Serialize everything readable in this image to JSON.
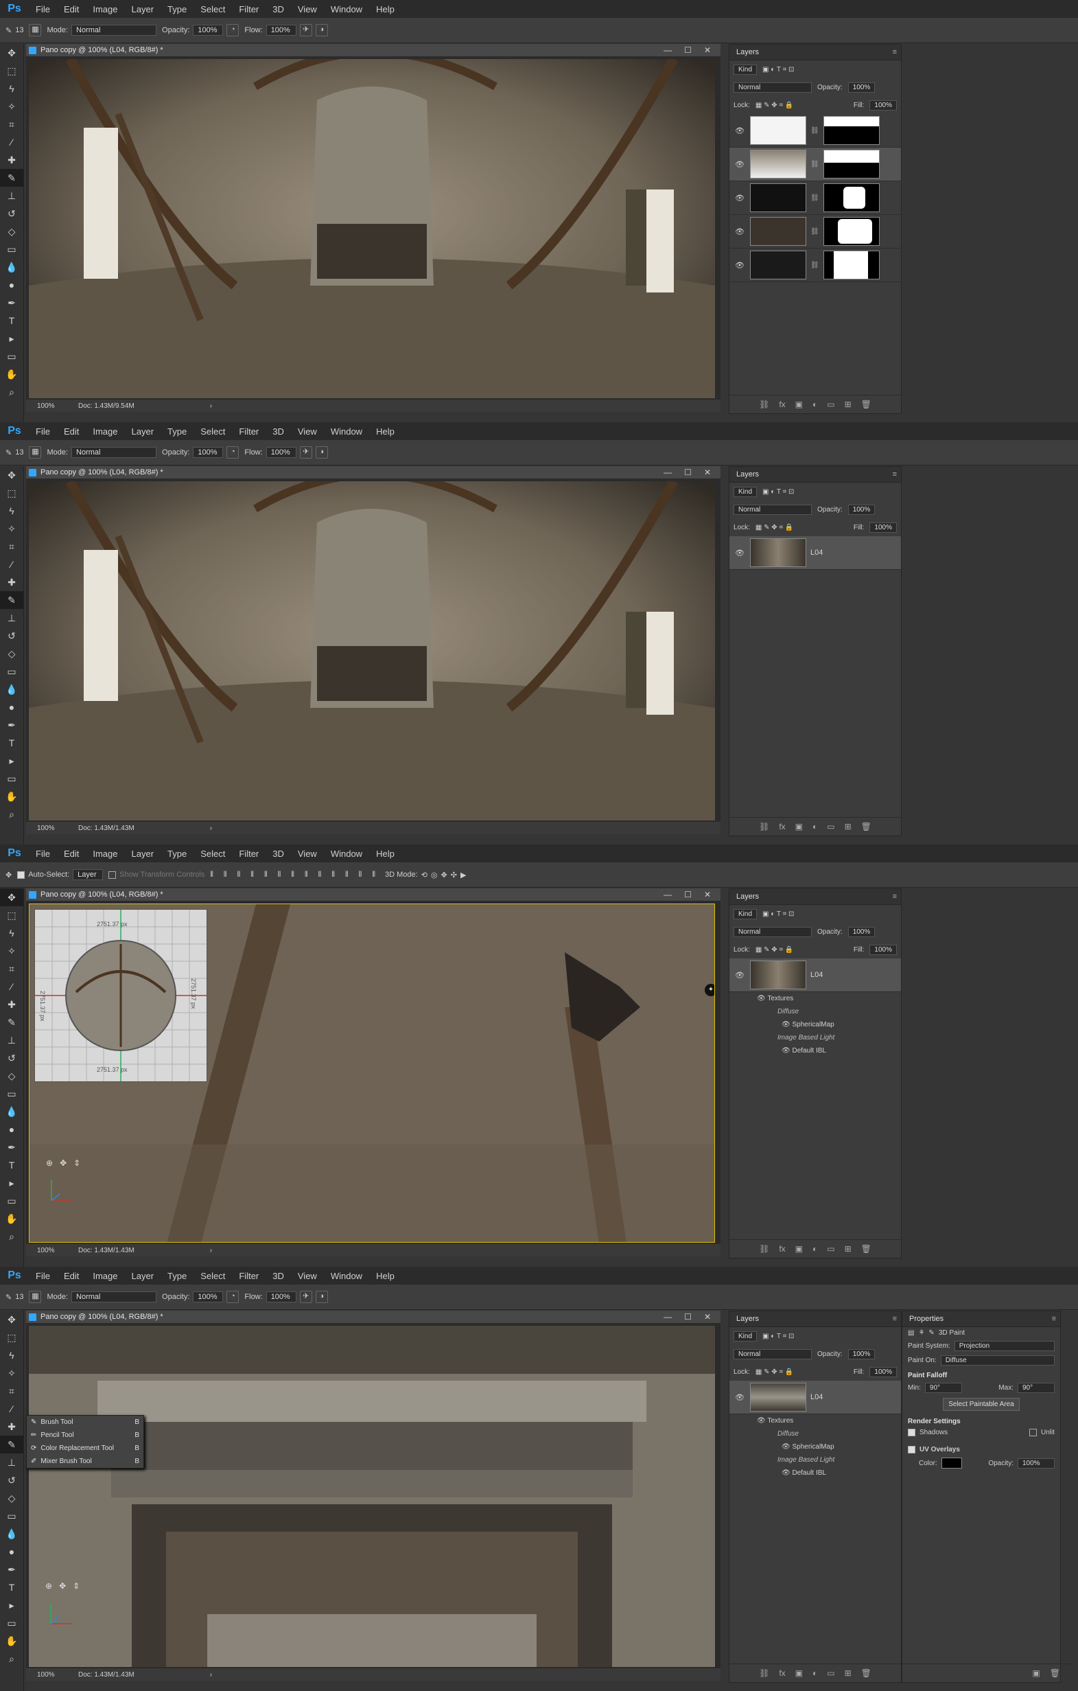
{
  "app": {
    "logo": "Ps"
  },
  "menu": [
    "File",
    "Edit",
    "Image",
    "Layer",
    "Type",
    "Select",
    "Filter",
    "3D",
    "View",
    "Window",
    "Help"
  ],
  "brush_options": {
    "brush_size": "13",
    "mode_label": "Mode:",
    "mode_value": "Normal",
    "opacity_label": "Opacity:",
    "opacity_value": "100%",
    "flow_label": "Flow:",
    "flow_value": "100%"
  },
  "move_options": {
    "auto_select_label": "Auto-Select:",
    "auto_select_target": "Layer",
    "transform_label": "Show Transform Controls",
    "mode_3d_label": "3D Mode:"
  },
  "doc": {
    "title": "Pano copy @ 100% (L04, RGB/8#) *",
    "zoom": "100%"
  },
  "status": {
    "screen1": "Doc: 1.43M/9.54M",
    "screen2": "Doc: 1.43M/1.43M",
    "screen3": "Doc: 1.43M/1.43M",
    "screen4": "Doc: 1.43M/1.43M"
  },
  "layers_panel": {
    "title": "Layers",
    "kind": "Kind",
    "blend": "Normal",
    "opacity_label": "Opacity:",
    "opacity": "100%",
    "lock_label": "Lock:",
    "fill_label": "Fill:",
    "fill": "100%",
    "layer_name": "L04",
    "textures": "Textures",
    "diffuse": "Diffuse",
    "spherical_map": "SphericalMap",
    "ibl": "Image Based Light",
    "default_ibl": "Default IBL"
  },
  "nav": {
    "dim_top": "2751.37 px",
    "dim_left": "2751.37 px",
    "dim_right": "2751.37 px",
    "dim_bottom": "2751.37 px"
  },
  "flyout": [
    {
      "label": "Brush Tool",
      "key": "B"
    },
    {
      "label": "Pencil Tool",
      "key": "B"
    },
    {
      "label": "Color Replacement Tool",
      "key": "B"
    },
    {
      "label": "Mixer Brush Tool",
      "key": "B"
    }
  ],
  "properties": {
    "title": "Properties",
    "mode": "3D Paint",
    "paint_system_label": "Paint System:",
    "paint_system": "Projection",
    "paint_on_label": "Paint On:",
    "paint_on": "Diffuse",
    "falloff_header": "Paint Falloff",
    "min_label": "Min:",
    "min": "90°",
    "max_label": "Max:",
    "max": "90°",
    "select_btn": "Select Paintable Area",
    "render_header": "Render Settings",
    "shadows": "Shadows",
    "unlit": "Unlit",
    "uv_overlays": "UV Overlays",
    "color_label": "Color:",
    "opacity_label": "Opacity:",
    "opacity": "100%",
    "color_value": "#000000"
  },
  "colors": {
    "accent": "#31a8ff",
    "selection": "#e0c000"
  }
}
